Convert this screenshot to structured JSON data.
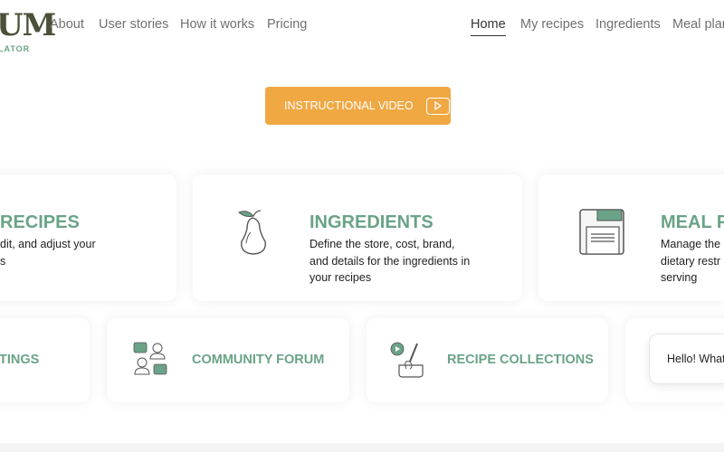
{
  "logo": {
    "main": "UM",
    "sub": "LATOR"
  },
  "nav_left": [
    "About",
    "User stories",
    "How it works",
    "Pricing"
  ],
  "nav_right": [
    "Home",
    "My recipes",
    "Ingredients",
    "Meal plan"
  ],
  "video_button": "INSTRUCTIONAL VIDEO",
  "cards": [
    {
      "title": "RECIPES",
      "desc": [
        "dit, and adjust your",
        "s"
      ]
    },
    {
      "title": "INGREDIENTS",
      "desc": [
        "Define the store, cost, brand,",
        "and details for the ingredients in",
        "your recipes"
      ]
    },
    {
      "title": "MEAL P",
      "desc": [
        "Manage the",
        "dietary restr",
        "serving"
      ]
    }
  ],
  "small_cards": [
    "TINGS",
    "COMMUNITY FORUM",
    "RECIPE COLLECTIONS"
  ],
  "chat": "Hello! What",
  "colors": {
    "accent": "#6aa387",
    "button": "#f0a843"
  }
}
